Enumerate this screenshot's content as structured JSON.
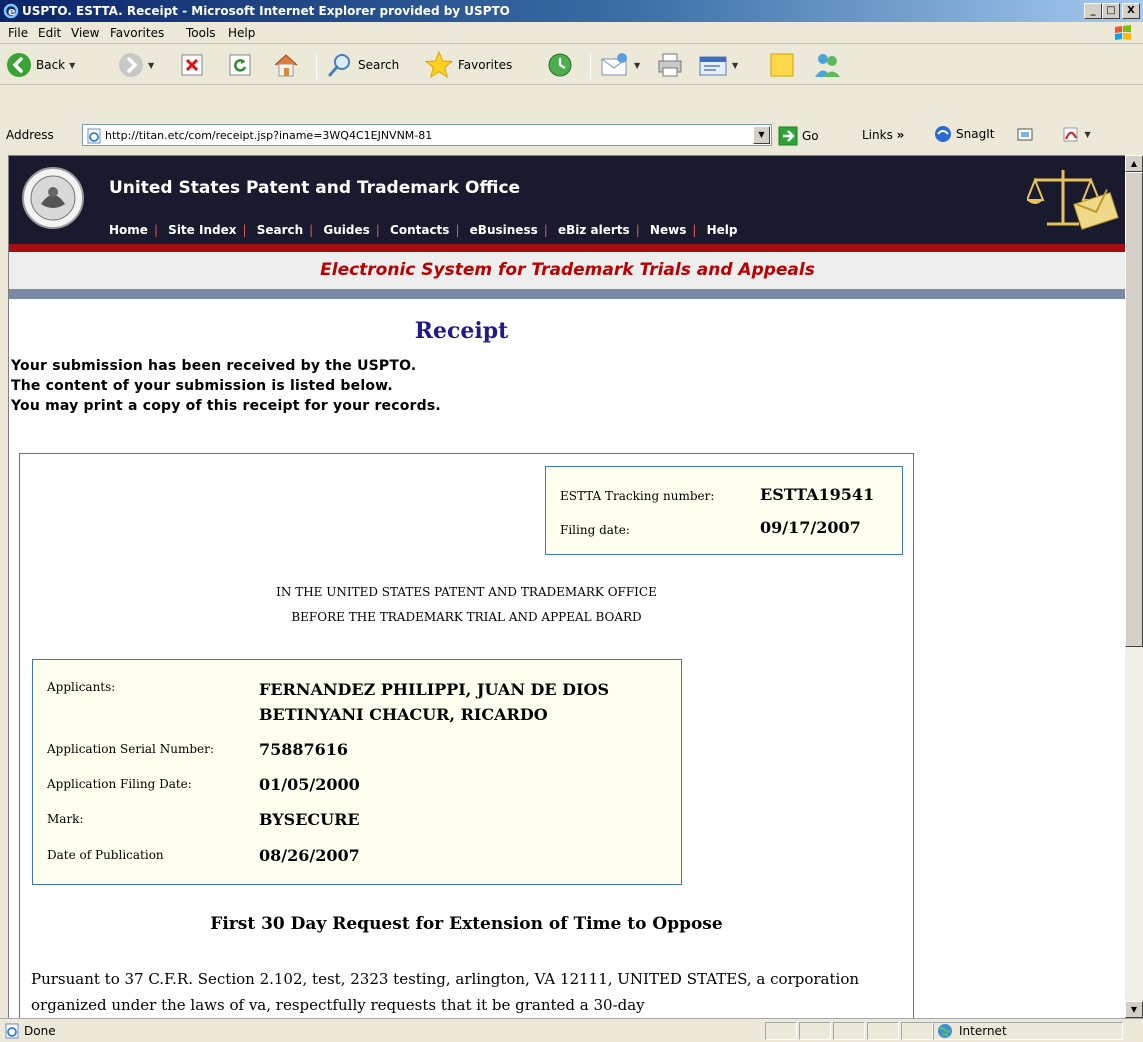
{
  "window": {
    "title": "USPTO. ESTTA. Receipt - Microsoft Internet Explorer provided by USPTO",
    "minimize": "_",
    "maximize": "□",
    "close": "X"
  },
  "menu": {
    "items": [
      "File",
      "Edit",
      "View",
      "Favorites",
      "Tools",
      "Help"
    ]
  },
  "toolbar": {
    "back": "Back",
    "search": "Search",
    "favorites": "Favorites"
  },
  "address": {
    "label": "Address",
    "url": "http://titan.etc/com/receipt.jsp?iname=3WQ4C1EJNVNM-81",
    "go": "Go",
    "links": "Links",
    "links_more": "»",
    "snagit": "SnagIt"
  },
  "banner": {
    "office": "United States Patent and Trademark Office",
    "nav": [
      "Home",
      "Site Index",
      "Search",
      "Guides",
      "Contacts",
      "eBusiness",
      "eBiz alerts",
      "News",
      "Help"
    ],
    "system": "Electronic System for Trademark Trials and Appeals"
  },
  "receipt": {
    "title": "Receipt",
    "lines": [
      "Your submission has been received by the USPTO.",
      "The content of your submission is listed below.",
      "You may print a copy of this receipt for your records."
    ]
  },
  "tracking": {
    "number_label": "ESTTA Tracking number:",
    "number": "ESTTA19541",
    "date_label": "Filing date:",
    "date": "09/17/2007"
  },
  "board": {
    "line1": "IN THE UNITED STATES PATENT AND TRADEMARK OFFICE",
    "line2": "BEFORE THE TRADEMARK TRIAL AND APPEAL BOARD"
  },
  "application": {
    "applicants_label": "Applicants:",
    "applicants": [
      "FERNANDEZ PHILIPPI, JUAN DE DIOS",
      "BETINYANI CHACUR, RICARDO"
    ],
    "serial_label": "Application Serial Number:",
    "serial": "75887616",
    "filing_label": "Application Filing Date:",
    "filing": "01/05/2000",
    "mark_label": "Mark:",
    "mark": "BYSECURE",
    "publication_label": "Date of Publication",
    "publication": "08/26/2007"
  },
  "request": {
    "title": "First 30 Day Request for Extension of Time to Oppose",
    "paragraph": "Pursuant to 37 C.F.R. Section 2.102, test, 2323 testing, arlington, VA 12111, UNITED STATES, a corporation organized under the laws of va, respectfully requests that it be granted a 30-day"
  },
  "status": {
    "text": "Done",
    "zone": "Internet"
  }
}
